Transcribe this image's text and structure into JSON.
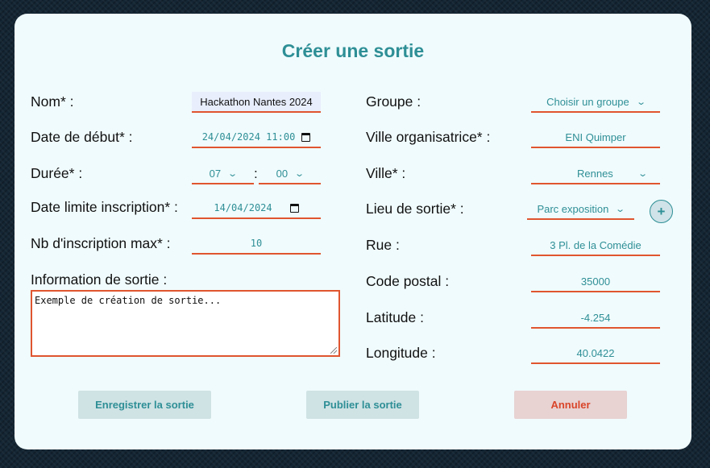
{
  "title": "Créer une sortie",
  "left": {
    "nom_label": "Nom* :",
    "nom_value": "Hackathon Nantes 2024",
    "date_debut_label": "Date de début* :",
    "date_debut_value": "24/04/2024 11:00",
    "duree_label": "Durée* :",
    "duree_hours": "07",
    "duree_sep": ":",
    "duree_minutes": "00",
    "date_limite_label": "Date limite inscription* :",
    "date_limite_value": "14/04/2024",
    "nb_label": "Nb d'inscription max* :",
    "nb_value": "10",
    "info_label": "Information de sortie :",
    "info_value": "Exemple de création de sortie..."
  },
  "right": {
    "groupe_label": "Groupe :",
    "groupe_value": "Choisir un groupe",
    "ville_org_label": "Ville organisatrice* :",
    "ville_org_value": "ENI Quimper",
    "ville_label": "Ville* :",
    "ville_value": "Rennes",
    "lieu_label": "Lieu de sortie* :",
    "lieu_value": "Parc exposition",
    "add_lieu": "+",
    "rue_label": "Rue :",
    "rue_value": "3 Pl. de la Comédie",
    "cp_label": "Code postal :",
    "cp_value": "35000",
    "lat_label": "Latitude :",
    "lat_value": "-4.254",
    "lng_label": "Longitude :",
    "lng_value": "40.0422"
  },
  "buttons": {
    "save": "Enregistrer la sortie",
    "publish": "Publier la sortie",
    "cancel": "Annuler"
  },
  "icons": {
    "chevron": "chevron-down-icon",
    "calendar": "calendar-icon",
    "plus": "plus-icon"
  },
  "colors": {
    "accent": "#2e8f96",
    "underline": "#e0552f",
    "cancel_text": "#d9452a",
    "card_bg": "#f0fbfd"
  }
}
